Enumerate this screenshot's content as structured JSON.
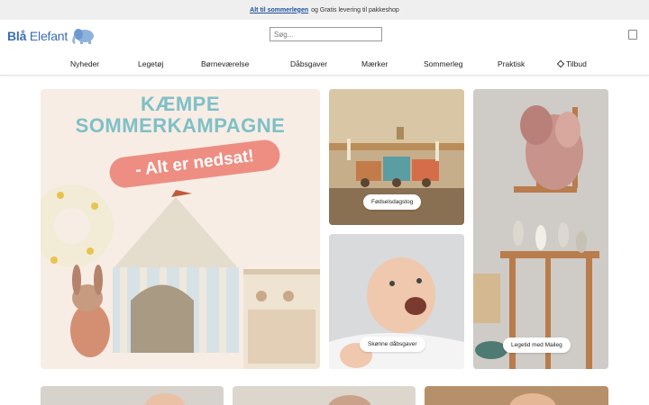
{
  "announcement": {
    "link_text": "Alt til sommerlegen",
    "rest_text": "og Gratis levering til pakkeshop"
  },
  "header": {
    "logo_word1": "Blå",
    "logo_word2": "Elefant",
    "logo_icon": "elephant-icon",
    "search_placeholder": "Søg...",
    "cart_icon": "cart-icon"
  },
  "nav": {
    "items": [
      {
        "label": "Nyheder"
      },
      {
        "label": "Legetøj"
      },
      {
        "label": "Børneværelse"
      },
      {
        "label": "Dåbsgaver"
      },
      {
        "label": "Mærker"
      },
      {
        "label": "Sommerleg"
      },
      {
        "label": "Praktisk"
      },
      {
        "label": "Tilbud",
        "icon": "tag-icon"
      }
    ]
  },
  "promo": {
    "title_line1": "KÆMPE",
    "title_line2": "SOMMERKAMPAGNE",
    "banner": "- Alt er nedsat!"
  },
  "tiles": [
    {
      "label": "Fødselsdagstog"
    },
    {
      "label": "Skønne dåbsgaver"
    },
    {
      "label": "Legetid med Maileg"
    }
  ],
  "colors": {
    "brand_blue": "#3b6db5",
    "promo_title": "#7fc0c6",
    "promo_banner": "#ee8e82"
  }
}
